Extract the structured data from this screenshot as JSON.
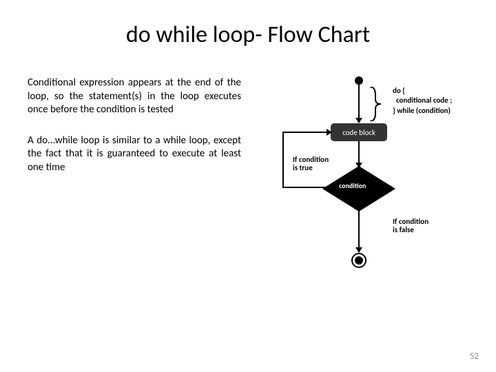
{
  "title": "do while loop- Flow Chart",
  "paragraphs": {
    "p1": "Conditional expression appears at the end of the loop, so the statement(s) in the loop executes once before the condition is tested",
    "p2": "A do...while loop is similar to a while loop, except the fact that it is guaranteed to execute at least one time"
  },
  "flowchart": {
    "code_block_label": "code block",
    "condition_label": "condition",
    "true_label_line1": "If condition",
    "true_label_line2": "is true",
    "false_label_line1": "If condition",
    "false_label_line2": "is false",
    "syntax_line1": "do {",
    "syntax_line2": "  conditional code ;",
    "syntax_line3": "} while (condition)"
  },
  "page_number": "52"
}
